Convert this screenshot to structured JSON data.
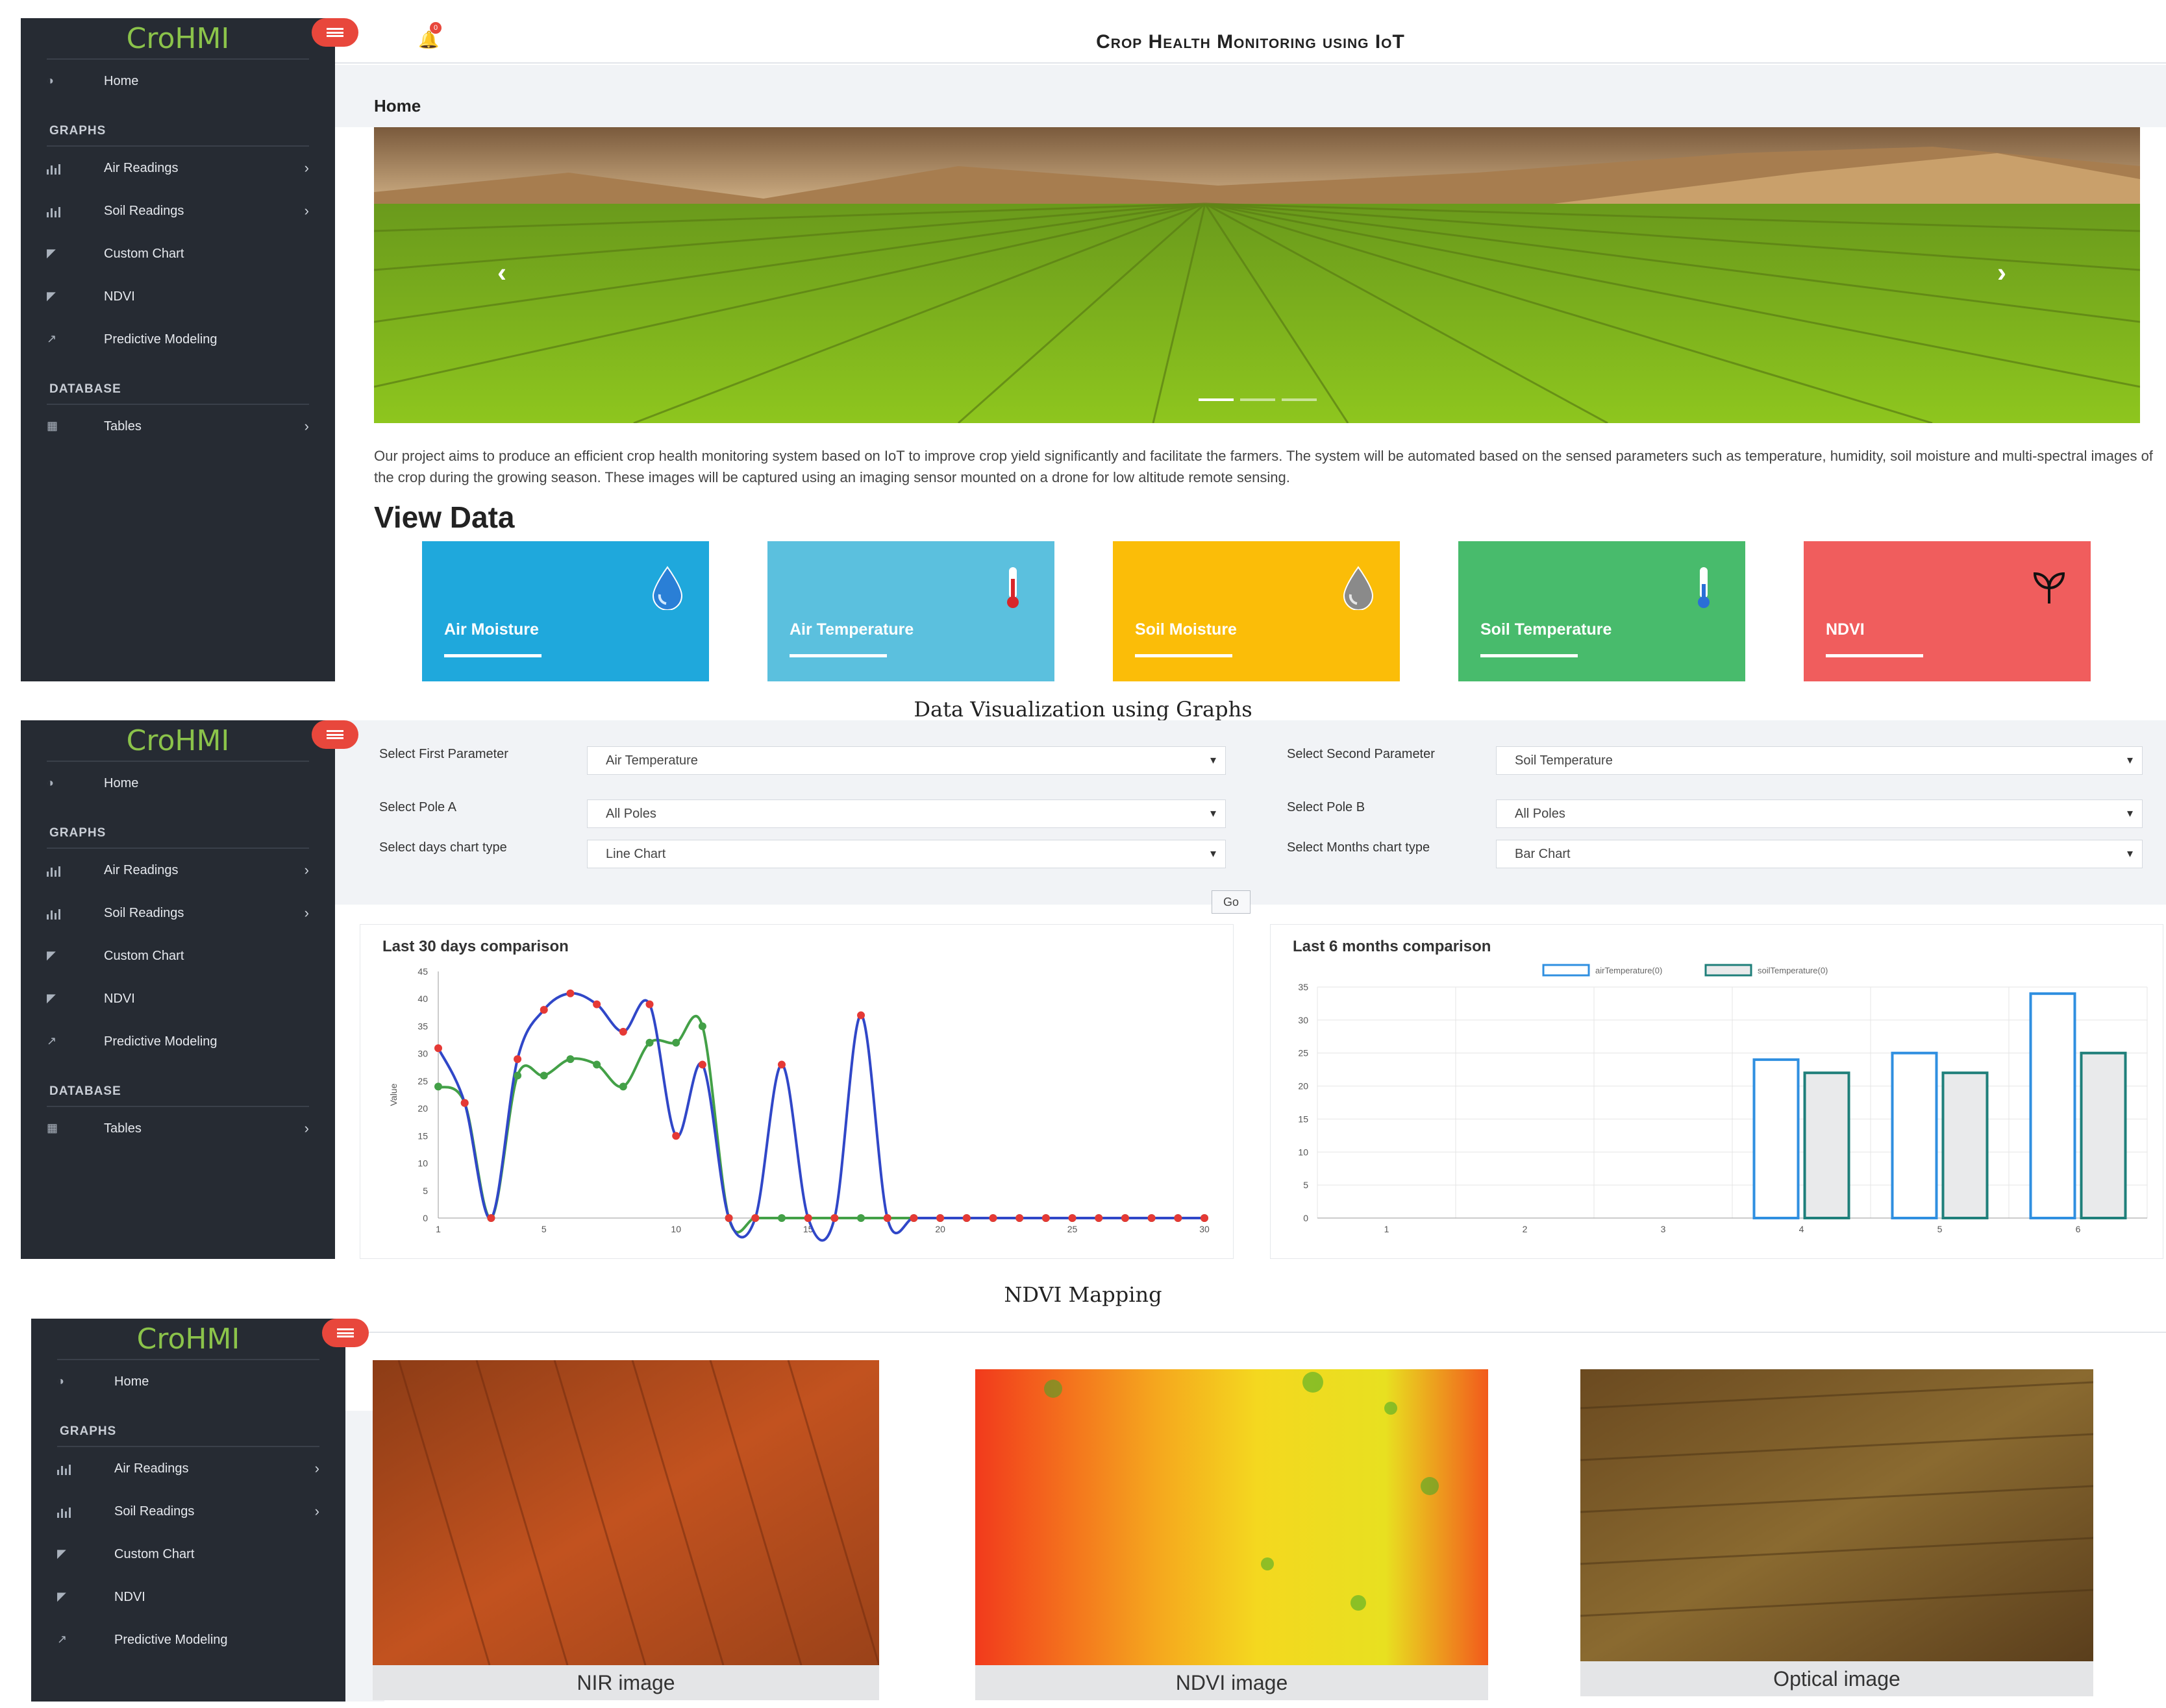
{
  "brand": "CroHMI",
  "app_title": "Crop Health Monitoring using IoT",
  "notifications_count": "0",
  "breadcrumb": "Home",
  "sidebar": {
    "home": "Home",
    "graphs_heading": "GRAPHS",
    "items": [
      {
        "label": "Air Readings",
        "icon": "bar-chart-icon",
        "submenu": true
      },
      {
        "label": "Soil Readings",
        "icon": "bar-chart-icon",
        "submenu": true
      },
      {
        "label": "Custom Chart",
        "icon": "area-chart-icon",
        "submenu": false
      },
      {
        "label": "NDVI",
        "icon": "area-chart-icon",
        "submenu": false
      },
      {
        "label": "Predictive Modeling",
        "icon": "line-chart-icon",
        "submenu": false
      }
    ],
    "database_heading": "DATABASE",
    "tables": "Tables"
  },
  "carousel": {
    "prev": "‹",
    "next": "›",
    "slides": 3,
    "active": 0
  },
  "intro_text": "Our project aims to produce an efficient crop health monitoring system based on IoT to improve crop yield significantly and facilitate the farmers. The system will be automated based on the sensed parameters such as temperature, humidity, soil moisture and multi-spectral images of the crop during the growing season. These images will be captured using an imaging sensor mounted on a drone for low altitude remote sensing.",
  "view_data_heading": "View Data",
  "tiles": [
    {
      "label": "Air Moisture",
      "color": "#1fa8dc",
      "icon": "water-drop-icon"
    },
    {
      "label": "Air Temperature",
      "color": "#5bc0de",
      "icon": "thermometer-icon"
    },
    {
      "label": "Soil Moisture",
      "color": "#fbbd08",
      "icon": "water-drop-icon"
    },
    {
      "label": "Soil Temperature",
      "color": "#48bb6c",
      "icon": "thermometer-icon"
    },
    {
      "label": "NDVI",
      "color": "#f05d5d",
      "icon": "plant-icon"
    }
  ],
  "captions": {
    "graphs": "Data Visualization using Graphs",
    "ndvi": "NDVI Mapping"
  },
  "form": {
    "first_param_label": "Select First Parameter",
    "first_param_value": "Air Temperature",
    "second_param_label": "Select Second Parameter",
    "second_param_value": "Soil Temperature",
    "pole_a_label": "Select Pole A",
    "pole_a_value": "All Poles",
    "pole_b_label": "Select Pole B",
    "pole_b_value": "All Poles",
    "days_chart_label": "Select days chart type",
    "days_chart_value": "Line Chart",
    "months_chart_label": "Select Months chart type",
    "months_chart_value": "Bar Chart",
    "go": "Go"
  },
  "images": [
    {
      "caption": "NIR image"
    },
    {
      "caption": "NDVI image"
    },
    {
      "caption": "Optical image"
    }
  ],
  "chart_data": [
    {
      "type": "line",
      "title": "Last 30 days comparison",
      "ylabel": "Value",
      "x": [
        1,
        2,
        3,
        4,
        5,
        6,
        7,
        8,
        9,
        10,
        11,
        12,
        13,
        14,
        15,
        16,
        17,
        18,
        19,
        20,
        21,
        22,
        23,
        24,
        25,
        26,
        27,
        28,
        29,
        30
      ],
      "xticks": [
        1,
        5,
        10,
        15,
        20,
        25,
        30
      ],
      "yticks": [
        0,
        5,
        10,
        15,
        20,
        25,
        30,
        35,
        40,
        45
      ],
      "ylim": [
        0,
        45
      ],
      "series": [
        {
          "color": "#e53935",
          "line": "#3047c8",
          "values": [
            31,
            21,
            0,
            29,
            38,
            41,
            39,
            34,
            39,
            15,
            28,
            0,
            0,
            28,
            0,
            0,
            37,
            0,
            0,
            0,
            0,
            0,
            0,
            0,
            0,
            0,
            0,
            0,
            0,
            0
          ]
        },
        {
          "color": "#43a047",
          "values": [
            24,
            21,
            0,
            26,
            26,
            29,
            28,
            24,
            32,
            32,
            35,
            0,
            0,
            0,
            0,
            0,
            0,
            0,
            0,
            0,
            0,
            0,
            0,
            0,
            0,
            0,
            0,
            0,
            0,
            0
          ]
        }
      ]
    },
    {
      "type": "bar",
      "title": "Last 6 months comparison",
      "categories": [
        "1",
        "2",
        "3",
        "4",
        "5",
        "6"
      ],
      "yticks": [
        0,
        5,
        10,
        15,
        20,
        25,
        30,
        35
      ],
      "ylim": [
        0,
        35
      ],
      "series": [
        {
          "name": "airTemperature(0)",
          "color": "#2f8fe0",
          "values": [
            0,
            0,
            0,
            24,
            25,
            34
          ]
        },
        {
          "name": "soilTemperature(0)",
          "color": "#1f7f7a",
          "values": [
            0,
            0,
            0,
            22,
            22,
            25
          ]
        }
      ]
    }
  ]
}
